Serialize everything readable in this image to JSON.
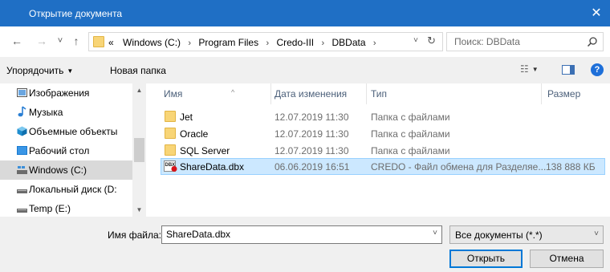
{
  "window": {
    "title": "Открытие документа",
    "close_glyph": "✕"
  },
  "nav": {
    "back_glyph": "←",
    "forward_glyph": "→",
    "recent_glyph": "˅",
    "up_glyph": "↑",
    "overflow": "«",
    "breadcrumbs": [
      "Windows (C:)",
      "Program Files",
      "Credo-III",
      "DBData"
    ],
    "breadcrumb_sep": "›",
    "dropdown_glyph": "˅",
    "refresh_glyph": "↻",
    "search_placeholder": "Поиск: DBData"
  },
  "toolbar": {
    "organize_label": "Упорядочить",
    "caret": "▼",
    "new_folder_label": "Новая папка",
    "view_glyph": "☷",
    "help_glyph": "?"
  },
  "sidebar": {
    "scroll_up": "▲",
    "scroll_down": "▼",
    "items": [
      {
        "label": "Изображения",
        "icon": "pictures-icon",
        "color": "#4a8fd6"
      },
      {
        "label": "Музыка",
        "icon": "music-icon",
        "color": "#2a7fd4"
      },
      {
        "label": "Объемные объекты",
        "icon": "3d-objects-icon",
        "color": "#2aa1d6"
      },
      {
        "label": "Рабочий стол",
        "icon": "desktop-icon",
        "color": "#1a7ad0"
      },
      {
        "label": "Windows (C:)",
        "icon": "system-drive-icon",
        "color": "#3b8fd9",
        "selected": true
      },
      {
        "label": "Локальный диск (D:",
        "icon": "drive-icon",
        "color": "#6b6b6b"
      },
      {
        "label": "Temp (E:)",
        "icon": "drive-icon",
        "color": "#6b6b6b"
      }
    ]
  },
  "files": {
    "sort_glyph": "^",
    "columns": {
      "name": "Имя",
      "date": "Дата изменения",
      "type": "Тип",
      "size": "Размер"
    },
    "rows": [
      {
        "name": "Jet",
        "date": "12.07.2019 11:30",
        "type": "Папка с файлами",
        "size": "",
        "icon": "folder-icon"
      },
      {
        "name": "Oracle",
        "date": "12.07.2019 11:30",
        "type": "Папка с файлами",
        "size": "",
        "icon": "folder-icon"
      },
      {
        "name": "SQL Server",
        "date": "12.07.2019 11:30",
        "type": "Папка с файлами",
        "size": "",
        "icon": "folder-icon"
      },
      {
        "name": "ShareData.dbx",
        "date": "06.06.2019 16:51",
        "type": "CREDO - Файл обмена для Разделяе...",
        "size": "138 888 КБ",
        "icon": "dbx-file-icon",
        "icon_text": "DBX",
        "selected": true
      }
    ]
  },
  "bottom": {
    "filename_label": "Имя файла:",
    "filename_value": "ShareData.dbx",
    "filetype_value": "Все документы (*.*)",
    "dropdown_glyph": "˅",
    "open_label": "Открыть",
    "cancel_label": "Отмена"
  },
  "colors": {
    "titlebar": "#1f6fc5",
    "selection": "#cce8ff",
    "selection_border": "#99d1ff",
    "folder": "#f8d577",
    "accent": "#0078d7"
  }
}
